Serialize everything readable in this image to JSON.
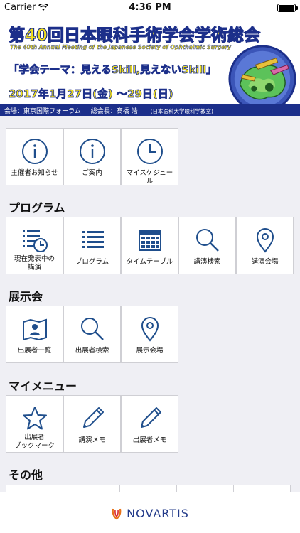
{
  "status": {
    "carrier": "Carrier",
    "time": "4:36 PM"
  },
  "banner": {
    "title": "第40回日本眼科手術学会学術総会",
    "subtitle_en": "The 40th Annual Meeting of the Japanese Society of Ophthalmic Surgery",
    "theme": "「学会テーマ：見えるSkill,見えないSkill」",
    "dates": "2017年1月27日(金) 〜29日(日)"
  },
  "infobar": {
    "venue": "会場：東京国際フォーラム",
    "president": "総会長：髙橋 浩",
    "affiliation": "(日本医科大学眼科学教室)"
  },
  "sections": {
    "top": [
      {
        "label": "主催者お知らせ",
        "icon": "info-icon"
      },
      {
        "label": "ご案内",
        "icon": "info-icon"
      },
      {
        "label": "マイスケジュール",
        "icon": "clock-icon"
      }
    ],
    "program": {
      "title": "プログラム",
      "items": [
        {
          "label": "現在発表中の\n講演",
          "icon": "list-clock-icon"
        },
        {
          "label": "プログラム",
          "icon": "list-icon"
        },
        {
          "label": "タイムテーブル",
          "icon": "calendar-icon"
        },
        {
          "label": "講演検索",
          "icon": "search-icon"
        },
        {
          "label": "講演会場",
          "icon": "map-pin-icon"
        }
      ]
    },
    "exhibition": {
      "title": "展示会",
      "items": [
        {
          "label": "出展者一覧",
          "icon": "exhibitor-map-icon"
        },
        {
          "label": "出展者検索",
          "icon": "search-icon"
        },
        {
          "label": "展示会場",
          "icon": "map-pin-icon"
        }
      ]
    },
    "mymenu": {
      "title": "マイメニュー",
      "items": [
        {
          "label": "出展者\nブックマーク",
          "icon": "star-icon"
        },
        {
          "label": "講演メモ",
          "icon": "pencil-icon"
        },
        {
          "label": "出展者メモ",
          "icon": "pencil-icon"
        }
      ]
    },
    "other": {
      "title": "その他"
    }
  },
  "footer": {
    "brand": "NOVARTIS"
  },
  "colors": {
    "icon": "#1f4e8c",
    "header_bar": "#1c2f8a",
    "title_yellow": "#f2e01c"
  }
}
